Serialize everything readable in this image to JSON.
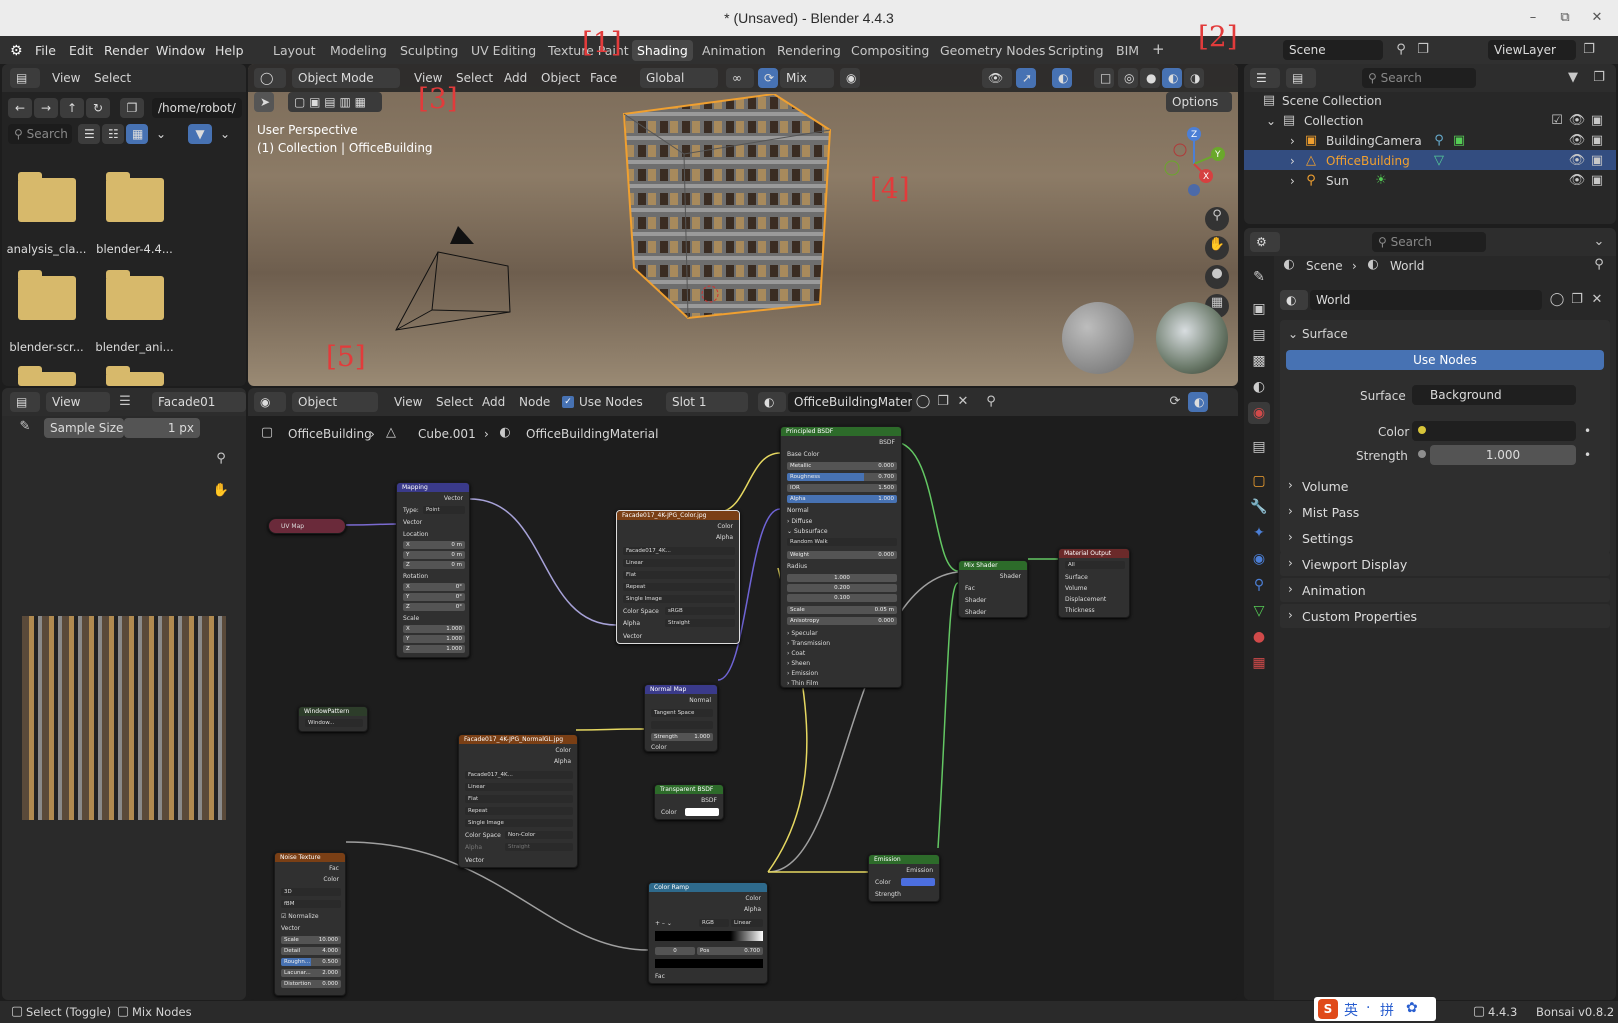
{
  "window": {
    "title": "* (Unsaved) - Blender 4.4.3"
  },
  "menus": [
    "File",
    "Edit",
    "Render",
    "Window",
    "Help"
  ],
  "workspaces": [
    "Layout",
    "Modeling",
    "Sculpting",
    "UV Editing",
    "Texture Paint",
    "Shading",
    "Animation",
    "Rendering",
    "Compositing",
    "Geometry Nodes",
    "Scripting",
    "BIM"
  ],
  "active_workspace": "Shading",
  "red_labels": [
    "[1]",
    "[2]",
    "[3]",
    "[4]",
    "[5]"
  ],
  "scene": {
    "name": "Scene",
    "view_layer": "ViewLayer"
  },
  "file_browser": {
    "view": "View",
    "select": "Select",
    "path": "/home/robot/",
    "search_placeholder": "Search",
    "items": [
      "analysis_cla...",
      "blender-4.4...",
      "blender-scr...",
      "blender_ani..."
    ]
  },
  "viewport": {
    "mode": "Object Mode",
    "menus": [
      "View",
      "Select",
      "Add",
      "Object",
      "Face"
    ],
    "orientation": "Global",
    "snap": "Mix",
    "options": "Options",
    "perspective": "User Perspective",
    "collection_info": "(1) Collection | OfficeBuilding",
    "axes": {
      "x": "X",
      "y": "Y",
      "z": "Z"
    }
  },
  "image_editor": {
    "view": "View",
    "image_name": "Facade01",
    "sample_label": "Sample Size",
    "sample_value": "1 px"
  },
  "node_editor": {
    "type": "Object",
    "menus": [
      "View",
      "Select",
      "Add",
      "Node"
    ],
    "use_nodes": "Use Nodes",
    "slot": "Slot 1",
    "material": "OfficeBuildingMaterial",
    "breadcrumb": [
      "OfficeBuilding",
      "Cube.001",
      "OfficeBuildingMaterial"
    ]
  },
  "nodes": {
    "uvmap": {
      "title": "UV Map"
    },
    "mapping": {
      "title": "Mapping",
      "out": "Vector",
      "type_label": "Type:",
      "type": "Point",
      "vector": "Vector",
      "location": "Location",
      "loc": [
        "X",
        "0 m",
        "Y",
        "0 m",
        "Z",
        "0 m"
      ],
      "rotation": "Rotation",
      "rot": [
        "X",
        "0°",
        "Y",
        "0°",
        "Z",
        "0°"
      ],
      "scale": "Scale",
      "scl": [
        "X",
        "1.000",
        "Y",
        "1.000",
        "Z",
        "1.000"
      ]
    },
    "color_tex": {
      "title": "Facade017_4K-JPG_Color.jpg",
      "outs": [
        "Color",
        "Alpha"
      ],
      "img": "Facade017_4K...",
      "opts": [
        "Linear",
        "Flat",
        "Repeat",
        "Single Image"
      ],
      "cs_label": "Color Space",
      "cs": "sRGB",
      "alpha_label": "Alpha",
      "alpha": "Straight",
      "vector": "Vector"
    },
    "bsdf": {
      "title": "Principled BSDF",
      "out": "BSDF",
      "base": "Base Color",
      "rows": [
        [
          "Metallic",
          "0.000"
        ],
        [
          "Roughness",
          "0.700"
        ],
        [
          "IOR",
          "1.500"
        ],
        [
          "Alpha",
          "1.000"
        ]
      ],
      "normal": "Normal",
      "diffuse": "Diffuse",
      "subsurface": "Subsurface",
      "ss_method": "Random Walk",
      "weight": [
        "Weight",
        "0.000"
      ],
      "radius": "Radius",
      "radius_vals": [
        "1.000",
        "0.200",
        "0.100"
      ],
      "scale": [
        "Scale",
        "0.05 m"
      ],
      "aniso": [
        "Anisotropy",
        "0.000"
      ],
      "panels": [
        "Specular",
        "Transmission",
        "Coat",
        "Sheen",
        "Emission",
        "Thin Film"
      ]
    },
    "mix": {
      "title": "Mix Shader",
      "out": "Shader",
      "ins": [
        "Fac",
        "Shader",
        "Shader"
      ]
    },
    "output": {
      "title": "Material Output",
      "target": "All",
      "ins": [
        "Surface",
        "Volume",
        "Displacement",
        "Thickness"
      ]
    },
    "normalmap": {
      "title": "Normal Map",
      "out": "Normal",
      "space": "Tangent Space",
      "strength": [
        "Strength",
        "1.000"
      ],
      "color": "Color"
    },
    "winpattern": {
      "title": "WindowPattern",
      "img": "Window..."
    },
    "normal_tex": {
      "title": "Facade017_4K-JPG_NormalGL.jpg",
      "outs": [
        "Color",
        "Alpha"
      ],
      "img": "Facade017_4K...",
      "opts": [
        "Linear",
        "Flat",
        "Repeat",
        "Single Image"
      ],
      "cs_label": "Color Space",
      "cs": "Non-Color",
      "alpha_label": "Alpha",
      "alpha": "Straight",
      "vector": "Vector"
    },
    "transparent": {
      "title": "Transparent BSDF",
      "out": "BSDF",
      "color": "Color"
    },
    "noise": {
      "title": "Noise Texture",
      "outs": [
        "Fac",
        "Color"
      ],
      "dim": "3D",
      "type": "fBM",
      "normalize": "Normalize",
      "vector": "Vector",
      "rows": [
        [
          "Scale",
          "10.000"
        ],
        [
          "Detail",
          "4.000"
        ],
        [
          "Roughn...",
          "0.500"
        ],
        [
          "Lacunar...",
          "2.000"
        ],
        [
          "Distortion",
          "0.000"
        ]
      ]
    },
    "colorramp": {
      "title": "Color Ramp",
      "outs": [
        "Color",
        "Alpha"
      ],
      "mode": "RGB",
      "interp": "Linear",
      "index": "0",
      "pos_label": "Pos",
      "pos": "0.700",
      "fac": "Fac"
    },
    "emission": {
      "title": "Emission",
      "out": "Emission",
      "ins": [
        "Color",
        "Strength"
      ]
    }
  },
  "outliner": {
    "search": "Search",
    "scene_collection": "Scene Collection",
    "collection": "Collection",
    "items": [
      "BuildingCamera",
      "OfficeBuilding",
      "Sun"
    ]
  },
  "properties": {
    "search": "Search",
    "breadcrumb": [
      "Scene",
      "World"
    ],
    "world": "World",
    "surface_panel": "Surface",
    "use_nodes": "Use Nodes",
    "surface_label": "Surface",
    "surface_value": "Background",
    "color_label": "Color",
    "strength_label": "Strength",
    "strength_value": "1.000",
    "panels": [
      "Volume",
      "Mist Pass",
      "Settings",
      "Viewport Display",
      "Animation",
      "Custom Properties"
    ]
  },
  "status": {
    "left1": "Select (Toggle)",
    "left2": "Mix Nodes",
    "version": "4.4.3",
    "addon": "Bonsai v0.8.2",
    "ime": [
      "S",
      "英",
      "·",
      "拼",
      "✿"
    ]
  },
  "colors": {
    "accent": "#4772b3",
    "selection": "#334d80",
    "orange": "#f0a030",
    "node_tex": "#7a3f15",
    "node_shader": "#2d6b2a",
    "node_vector": "#3a3a8a",
    "node_converter": "#2e6a8c",
    "node_output": "#6b2a2a"
  }
}
